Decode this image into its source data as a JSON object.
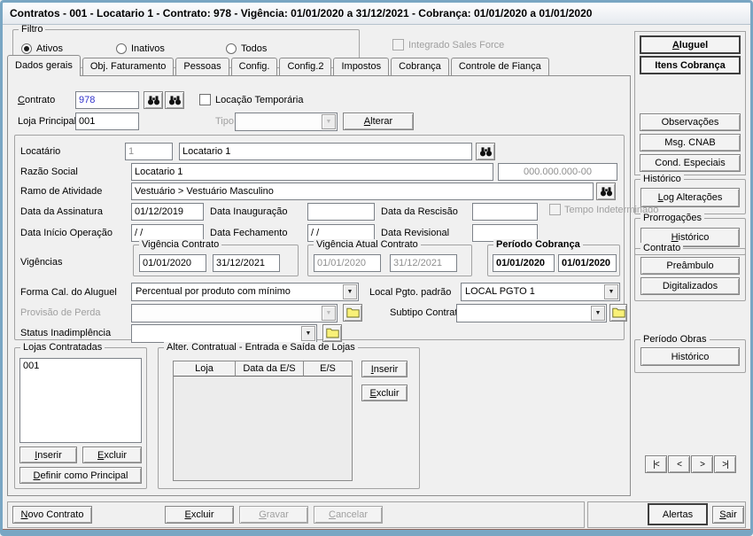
{
  "window": {
    "title": "Contratos - 001 - Locatario 1 - Contrato: 978 - Vigência: 01/01/2020 a 31/12/2021 - Cobrança: 01/01/2020 a 01/01/2020"
  },
  "colors": {
    "frame": "#79a6c3",
    "accent_value_text": "#3333cc",
    "disabled_text": "#9f9f9f",
    "folder_icon": "#f9f178"
  },
  "icons": {
    "search": "binoculars-icon",
    "folder": "open-folder-icon",
    "dropdown": "chevron-down-icon"
  },
  "filter": {
    "legend": "Filtro",
    "options": [
      {
        "label": "Ativos",
        "selected": true
      },
      {
        "label": "Inativos",
        "selected": false
      },
      {
        "label": "Todos",
        "selected": false
      }
    ]
  },
  "sales_force": {
    "label": "Integrado Sales Force",
    "checked": false,
    "enabled": false
  },
  "tabs": {
    "active": "Dados gerais",
    "items": [
      {
        "label": "Dados gerais"
      },
      {
        "label": "Obj. Faturamento"
      },
      {
        "label": "Pessoas"
      },
      {
        "label": "Config."
      },
      {
        "label": "Config.2"
      },
      {
        "label": "Impostos"
      },
      {
        "label": "Cobrança"
      },
      {
        "label": "Controle de Fiança"
      }
    ]
  },
  "form": {
    "contrato": {
      "label": "Contrato",
      "accel": "C",
      "value": "978"
    },
    "locacao_temporaria": {
      "label": "Locação Temporária",
      "checked": false
    },
    "loja_principal": {
      "label": "Loja Principal",
      "value": "001"
    },
    "tipo": {
      "label": "Tipo",
      "value": "",
      "enabled": false
    },
    "alterar": {
      "label": "Alterar",
      "accel": "A"
    },
    "locatario": {
      "label": "Locatário",
      "code": "1",
      "name": "Locatario 1"
    },
    "razao_social": {
      "label": "Razão Social",
      "value": "Locatario 1"
    },
    "documento": {
      "value": "000.000.000-00"
    },
    "ramo_atividade": {
      "label": "Ramo de Atividade",
      "value": "Vestuário > Vestuário Masculino"
    },
    "data_assinatura": {
      "label": "Data da Assinatura",
      "value": "01/12/2019"
    },
    "data_inauguracao": {
      "label": "Data Inauguração",
      "value": ""
    },
    "data_rescisao": {
      "label": "Data da Rescisão",
      "value": ""
    },
    "tempo_indeterminado": {
      "label": "Tempo Indeterminado",
      "checked": false,
      "enabled": false
    },
    "data_inicio_operacao": {
      "label": "Data Início Operação",
      "value": "/ /"
    },
    "data_fechamento": {
      "label": "Data Fechamento",
      "value": "/ /"
    },
    "data_revisional": {
      "label": "Data Revisional",
      "value": ""
    },
    "vigencias_label": "Vigências",
    "vigencia_contrato": {
      "legend": "Vigência Contrato",
      "inicio": "01/01/2020",
      "fim": "31/12/2021"
    },
    "vigencia_atual": {
      "legend": "Vigência Atual Contrato",
      "inicio": "01/01/2020",
      "fim": "31/12/2021",
      "enabled": false
    },
    "periodo_cobranca": {
      "legend": "Período Cobrança",
      "inicio": "01/01/2020",
      "fim": "01/01/2020"
    },
    "forma_calculo": {
      "label": "Forma Cal. do Aluguel",
      "value": "Percentual por produto com mínimo"
    },
    "local_pagamento": {
      "label": "Local Pgto. padrão",
      "value": "LOCAL PGTO 1"
    },
    "provisao_perda": {
      "label": "Provisão de Perda",
      "value": "",
      "enabled": false
    },
    "subtipo_contrato": {
      "label": "Subtipo Contrato",
      "value": ""
    },
    "status_inadimplencia": {
      "label": "Status Inadimplência",
      "value": ""
    },
    "lojas_contratadas": {
      "legend": "Lojas Contratadas",
      "items": [
        "001"
      ],
      "inserir": {
        "label": "Inserir",
        "accel": "I"
      },
      "excluir": {
        "label": "Excluir",
        "accel": "E"
      },
      "definir_principal": {
        "label": "Definir como Principal",
        "accel": "D"
      }
    },
    "alteracao_contratual": {
      "legend": "Alter. Contratual - Entrada e Saída de Lojas",
      "columns": [
        "Loja",
        "Data da E/S",
        "E/S"
      ],
      "rows": [],
      "inserir": {
        "label": "Inserir",
        "accel": "I"
      },
      "excluir": {
        "label": "Excluir",
        "accel": "E"
      }
    }
  },
  "sidebar": {
    "aluguel": {
      "label": "Aluguel",
      "accel": "A"
    },
    "itens_cobranca": {
      "label": "Itens Cobrança"
    },
    "observacoes": {
      "label": "Observações"
    },
    "msg_cnab": {
      "label": "Msg. CNAB"
    },
    "cond_especiais": {
      "label": "Cond. Especiais"
    },
    "historico_group": {
      "legend": "Histórico",
      "log_alteracoes": {
        "label": "Log Alterações",
        "accel": "L"
      }
    },
    "prorrogacoes_group": {
      "legend": "Prorrogações",
      "historico": {
        "label": "Histórico",
        "accel": "H"
      }
    },
    "contrato_group": {
      "legend": "Contrato",
      "preambulo": {
        "label": "Preâmbulo"
      },
      "digitalizados": {
        "label": "Digitalizados"
      }
    },
    "periodo_obras_group": {
      "legend": "Período Obras",
      "historico": {
        "label": "Histórico"
      }
    },
    "nav": {
      "first": "|<",
      "prev": "<",
      "next": ">",
      "last": ">|"
    }
  },
  "bottom": {
    "novo_contrato": {
      "label": "Novo Contrato",
      "accel": "N"
    },
    "excluir": {
      "label": "Excluir",
      "accel": "E"
    },
    "gravar": {
      "label": "Gravar",
      "accel": "G",
      "enabled": false
    },
    "cancelar": {
      "label": "Cancelar",
      "accel": "C",
      "enabled": false
    },
    "alertas": {
      "label": "Alertas"
    },
    "sair": {
      "label": "Sair",
      "accel": "S"
    }
  }
}
